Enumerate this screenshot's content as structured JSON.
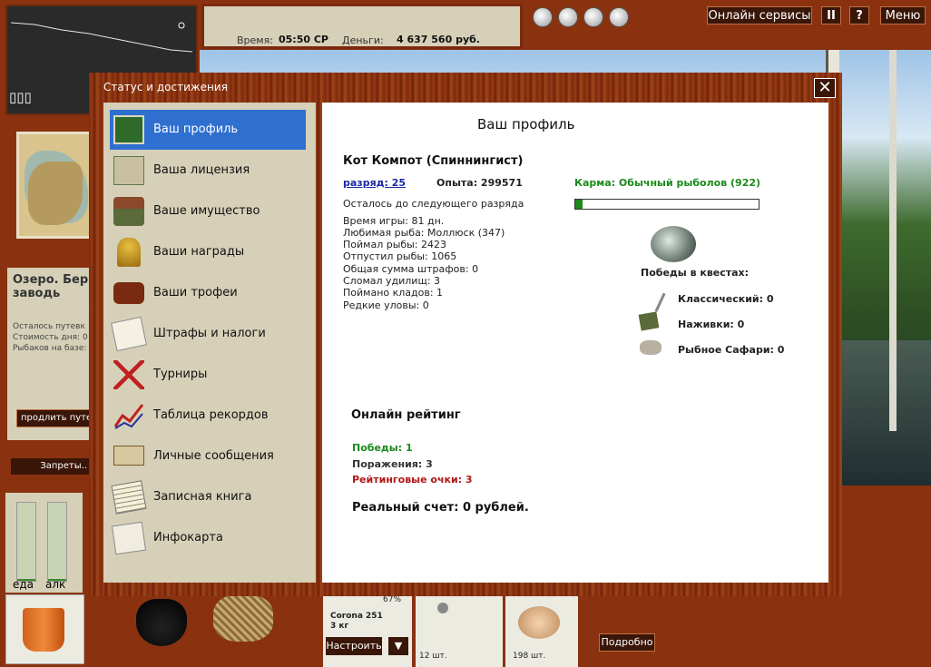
{
  "top": {
    "time_label": "Время:",
    "time_value": "05:50 СР",
    "money_label": "Деньги:",
    "money_value": "4 637 560 руб.",
    "online_services": "Онлайн сервисы",
    "pause": "II",
    "help": "?",
    "menu": "Меню"
  },
  "left": {
    "battery": "▯▯▯",
    "lake_title": "Озеро. Бер заводь",
    "lake_lines": [
      "Осталось путевк",
      "Стоимость дня: 0",
      "Рыбаков на базе:"
    ],
    "extend_button": "продлить путевк",
    "bans_button": "Запреты..",
    "food_label": "еда",
    "alc_label": "алк",
    "food_level": 0.02,
    "alc_level": 0.02
  },
  "bottom": {
    "tackle_name": "Corona 251",
    "tackle_weight": "3 кг",
    "tackle_percent": "67%",
    "setup_button": "Настроить",
    "dropdown": "▼",
    "bait1_count": "12 шт.",
    "bait2_count": "198 шт.",
    "detail_button": "Подробно"
  },
  "dialog": {
    "title": "Статус и достижения",
    "close": "✕",
    "menu": [
      {
        "label": "Ваш профиль",
        "icon": "profile-card-icon",
        "active": true
      },
      {
        "label": "Ваша лицензия",
        "icon": "license-icon",
        "active": false
      },
      {
        "label": "Ваше имущество",
        "icon": "car-property-icon",
        "active": false
      },
      {
        "label": "Ваши награды",
        "icon": "trophy-cup-icon",
        "active": false
      },
      {
        "label": "Ваши трофеи",
        "icon": "fish-plaque-icon",
        "active": false
      },
      {
        "label": "Штрафы и налоги",
        "icon": "fines-document-icon",
        "active": false
      },
      {
        "label": "Турниры",
        "icon": "crossed-rods-icon",
        "active": false
      },
      {
        "label": "Таблица рекордов",
        "icon": "records-graph-icon",
        "active": false
      },
      {
        "label": "Личные сообщения",
        "icon": "envelope-icon",
        "active": false
      },
      {
        "label": "Записная книга",
        "icon": "notebook-icon",
        "active": false
      },
      {
        "label": "Инфокарта",
        "icon": "infocard-icon",
        "active": false
      }
    ],
    "profile": {
      "heading": "Ваш профиль",
      "name": "Кот Компот (Спиннингист)",
      "rank_link": "разряд: 25",
      "experience": "Опыта: 299571",
      "to_next": "Осталось до следующего разряда",
      "karma": "Карма: Обычный рыболов (922)",
      "karma_progress": 0.04,
      "stats": [
        "Время игры: 81 дн.",
        "Любимая рыба: Моллюск (347)",
        "Поймал рыбы: 2423",
        "Отпустил рыбы: 1065",
        "Общая сумма штрафов: 0",
        "Сломал удилищ: 3",
        "Поймано кладов: 1",
        "Редкие уловы: 0"
      ],
      "quests_title": "Победы в квестах:",
      "quests": [
        {
          "label": "Классический: 0",
          "icon": "rod-quest-icon"
        },
        {
          "label": "Наживки: 0",
          "icon": "bait-box-quest-icon"
        },
        {
          "label": "Рыбное Сафари: 0",
          "icon": "safari-quest-icon"
        }
      ],
      "rating_title": "Онлайн рейтинг",
      "wins": "Победы: 1",
      "losses": "Поражения: 3",
      "rating_points": "Рейтинговые очки: 3",
      "real_account": "Реальный счет: 0 рублей.",
      "colors": {
        "green": "#1a8a1a",
        "red": "#b01818",
        "link": "#1a2aa0"
      }
    }
  }
}
